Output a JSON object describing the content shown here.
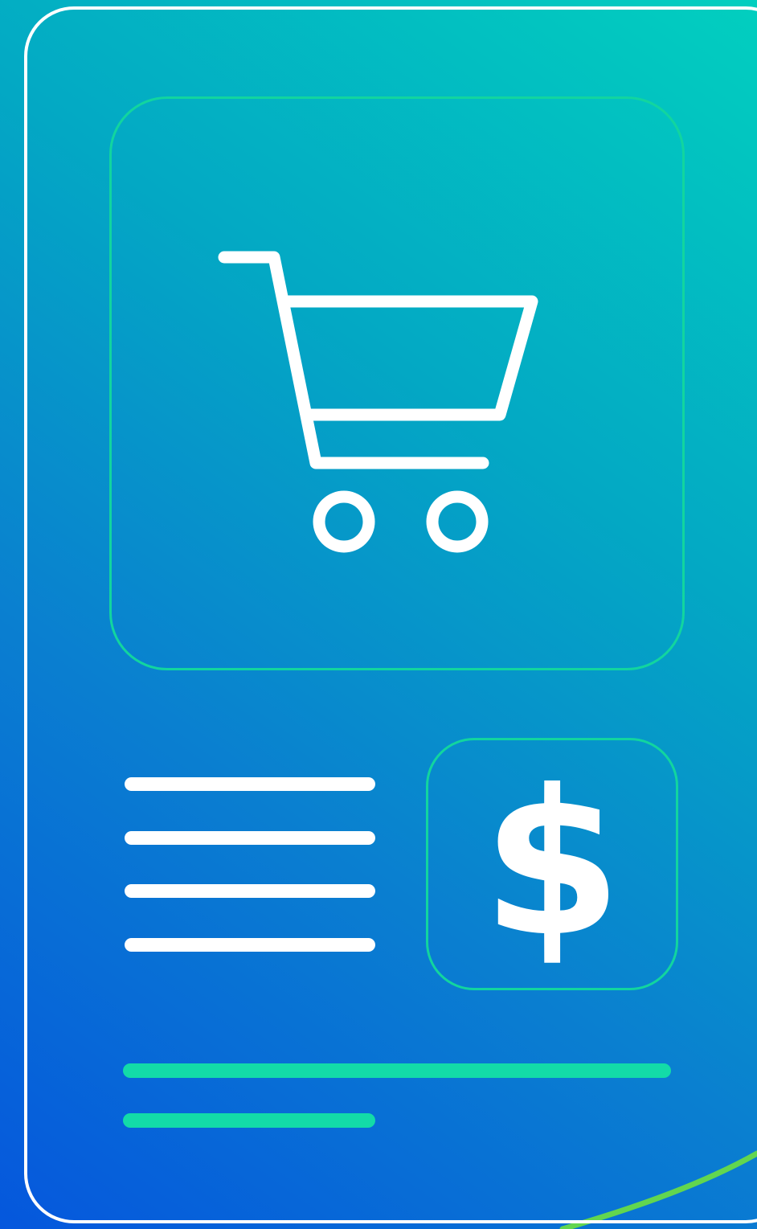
{
  "icons": {
    "cart": "shopping-cart-icon",
    "price": "dollar-icon"
  },
  "price_panel": {
    "symbol": "$"
  },
  "colors": {
    "background_start": "#0557dd",
    "background_end": "#02cfbf",
    "frame": "#ffffff",
    "panel_border": "#12d59f",
    "accent_line": "#13dba8",
    "placeholder_line": "#ffffff"
  }
}
